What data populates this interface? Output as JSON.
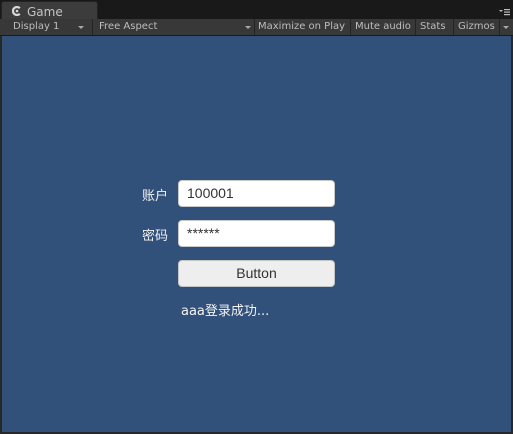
{
  "tab": {
    "title": "Game"
  },
  "toolbar": {
    "display": "Display 1",
    "aspect": "Free Aspect",
    "maximize": "Maximize on Play",
    "mute": "Mute audio",
    "stats": "Stats",
    "gizmos": "Gizmos"
  },
  "login": {
    "account_label": "账户",
    "account_value": "100001",
    "password_label": "密码",
    "password_value": "******",
    "button_label": "Button",
    "status_text": "aaa登录成功..."
  },
  "colors": {
    "game_background": "#31507a",
    "editor_background": "#282828"
  },
  "icons": {
    "tab": "unity-game-icon",
    "tab_menu": "menu-icon"
  }
}
